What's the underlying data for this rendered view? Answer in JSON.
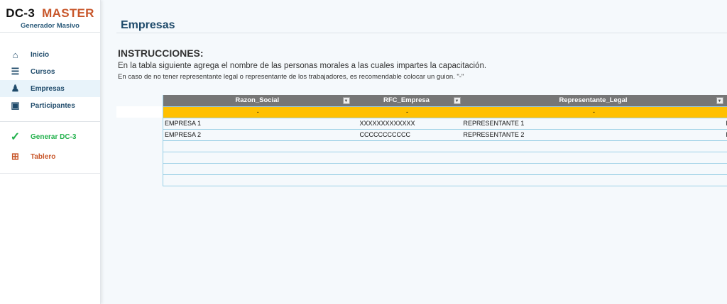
{
  "brand": {
    "name": "DC-3",
    "accent": "MASTER",
    "subtitle": "Generador Masivo"
  },
  "sidebar": {
    "items": [
      {
        "label": "Inicio",
        "icon": "home-icon"
      },
      {
        "label": "Cursos",
        "icon": "books-icon"
      },
      {
        "label": "Empresas",
        "icon": "office-chair-icon",
        "active": true
      },
      {
        "label": "Participantes",
        "icon": "id-card-icon"
      }
    ],
    "actions": [
      {
        "label": "Generar DC-3",
        "icon": "check-icon",
        "color": "#22b14c"
      },
      {
        "label": "Tablero",
        "icon": "dashboard-icon",
        "color": "#c8562a"
      }
    ]
  },
  "page": {
    "title": "Empresas",
    "instructions_title": "INSTRUCCIONES:",
    "line1": "En la tabla siguiente agrega el nombre de las personas morales a las cuales impartes la capacitación.",
    "line2": "En caso de no tener representante legal o representante de los trabajadores, es recomendable colocar un guion. \"-\""
  },
  "table": {
    "columns": [
      "Razon_Social",
      "RFC_Empresa",
      "Representante_Legal",
      ""
    ],
    "placeholder": [
      "-",
      "-",
      "-",
      ""
    ],
    "rows": [
      [
        "EMPRESA 1",
        "XXXXXXXXXXXXX",
        "REPRESENTANTE 1",
        "R"
      ],
      [
        "EMPRESA 2",
        "CCCCCCCCCCC",
        "REPRESENTANTE 2",
        "R"
      ],
      [
        "",
        "",
        "",
        ""
      ],
      [
        "",
        "",
        "",
        ""
      ],
      [
        "",
        "",
        "",
        ""
      ],
      [
        "",
        "",
        "",
        ""
      ]
    ]
  }
}
